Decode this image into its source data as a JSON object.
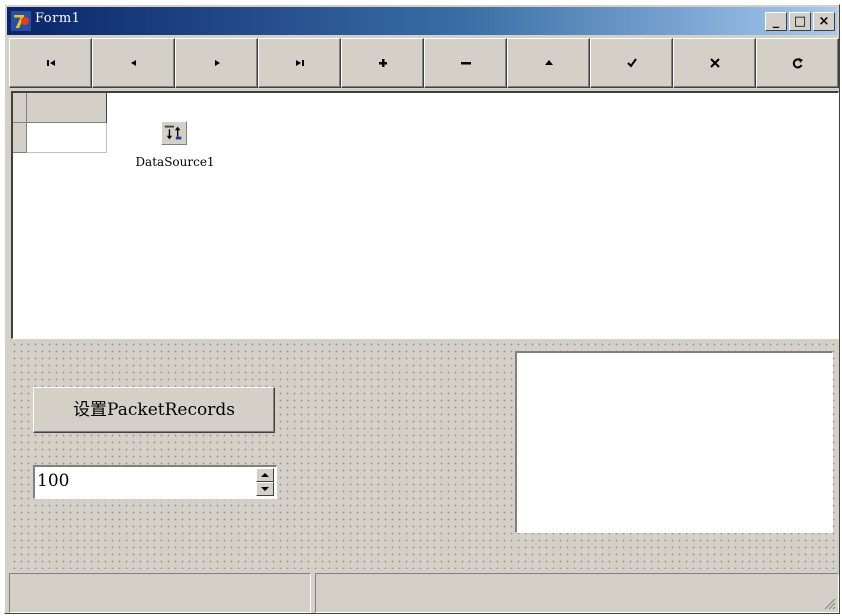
{
  "window": {
    "title": "Form1",
    "caption_buttons": [
      {
        "name": "minimize",
        "glyph": "_"
      },
      {
        "name": "maximize",
        "glyph": "□"
      },
      {
        "name": "close",
        "glyph": "×"
      }
    ]
  },
  "navigator": {
    "buttons": [
      {
        "name": "first",
        "icon": "first-record-icon"
      },
      {
        "name": "prior",
        "icon": "prior-record-icon"
      },
      {
        "name": "next",
        "icon": "next-record-icon"
      },
      {
        "name": "last",
        "icon": "last-record-icon"
      },
      {
        "name": "insert",
        "icon": "insert-record-icon"
      },
      {
        "name": "delete",
        "icon": "delete-record-icon"
      },
      {
        "name": "edit",
        "icon": "edit-record-icon"
      },
      {
        "name": "post",
        "icon": "post-record-icon"
      },
      {
        "name": "cancel",
        "icon": "cancel-record-icon"
      },
      {
        "name": "refresh",
        "icon": "refresh-record-icon"
      }
    ]
  },
  "datasource": {
    "label": "DataSource1",
    "icon": "datasource-icon"
  },
  "packet_button": {
    "label": "设置PacketRecords"
  },
  "spin_edit": {
    "value": "100"
  },
  "colors": {
    "face": "#d4d0c8",
    "title_start": "#0a246a",
    "title_end": "#a6caf0"
  }
}
